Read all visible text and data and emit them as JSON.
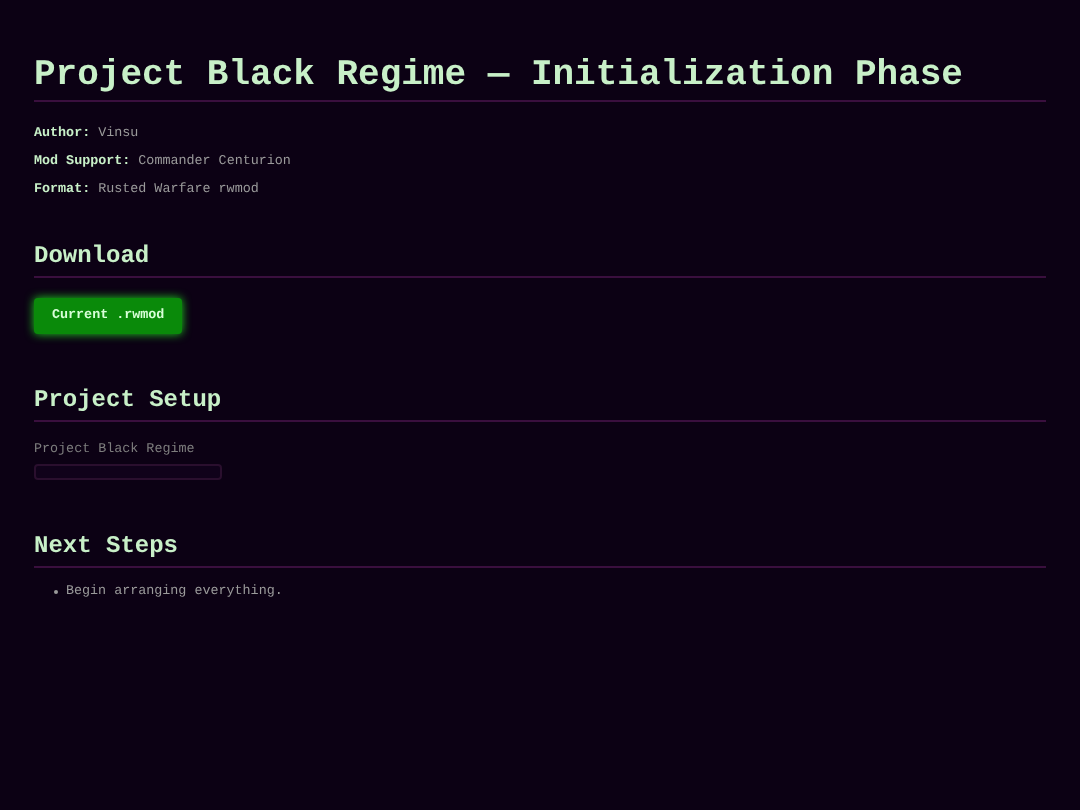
{
  "title": "Project Black Regime — Initialization Phase",
  "meta": [
    {
      "label": "Author:",
      "value": "Vinsu"
    },
    {
      "label": "Mod Support:",
      "value": "Commander Centurion"
    },
    {
      "label": "Format:",
      "value": "Rusted Warfare rwmod"
    }
  ],
  "download": {
    "heading": "Download",
    "button": "Current .rwmod"
  },
  "setup": {
    "heading": "Project Setup",
    "field_label": "Project Black Regime"
  },
  "next_steps": {
    "heading": "Next Steps",
    "items": [
      "Begin arranging everything."
    ]
  }
}
